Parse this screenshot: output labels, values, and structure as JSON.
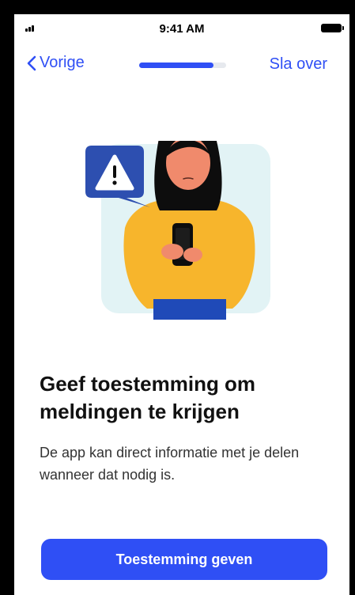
{
  "status_bar": {
    "time": "9:41 AM"
  },
  "nav": {
    "back_label": "Vorige",
    "skip_label": "Sla over",
    "progress": 0.85
  },
  "content": {
    "title": "Geef toestemming om meldingen te krijgen",
    "body": "De app kan direct informatie met je delen wanneer dat nodig is."
  },
  "actions": {
    "primary_label": "Toestemming geven"
  },
  "colors": {
    "accent": "#2f4ff5",
    "sweater": "#f7b52c",
    "hair": "#0d0d0d",
    "skin": "#f08a6c",
    "alert_bubble": "#2d4fb0",
    "illustration_bg": "#e2f3f5",
    "jeans": "#1f4ab8"
  }
}
